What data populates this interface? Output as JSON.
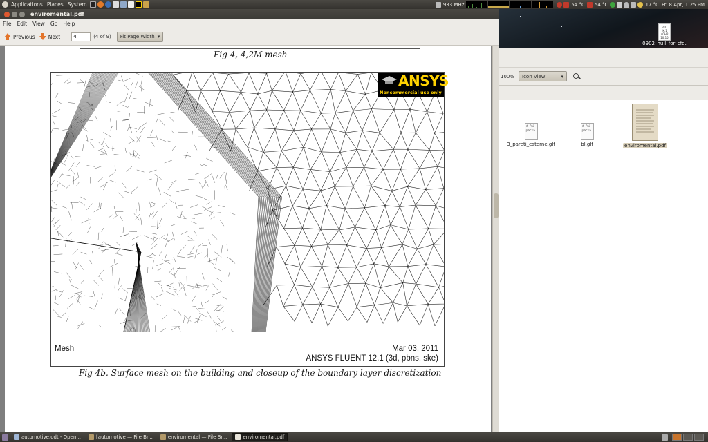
{
  "top_panel": {
    "menus": [
      "Applications",
      "Places",
      "System"
    ],
    "cpu_freq": "933 MHz",
    "temp_1": "54 °C",
    "temp_2": "54 °C",
    "weather": "17 °C",
    "clock": "Fri 8 Apr, 1:25 PM"
  },
  "desktop": {
    "file_label": "0902_hull_for_cfd.",
    "file_thumb_lines": [
      "PTC",
      "IK,1",
      "40HP",
      "10.15"
    ]
  },
  "file_browser": {
    "zoom": "100%",
    "view_mode": "Icon View",
    "files": [
      {
        "name": "3_pareti_esterne.glf",
        "thumb": [
          "# Poi",
          "packa"
        ],
        "selected": false
      },
      {
        "name": "bl.glf",
        "thumb": [
          "# Poi",
          "packa"
        ],
        "selected": false
      },
      {
        "name": "enviromental.pdf",
        "thumb": [],
        "selected": true
      }
    ]
  },
  "viewer": {
    "window_title": "enviromental.pdf",
    "menu": [
      "File",
      "Edit",
      "View",
      "Go",
      "Help"
    ],
    "previous_label": "Previous",
    "next_label": "Next",
    "page_value": "4",
    "page_count": "(4 of 9)",
    "zoom_mode": "Fit Page Width"
  },
  "document": {
    "caption_top": "Fig 4, 4,2M mesh",
    "caption_bottom": "Fig 4b. Surface mesh on the building and closeup of the boundary layer discretization",
    "figure": {
      "logo_text": "ANSYS",
      "logo_subtext": "Noncommercial use only",
      "footer_left": "Mesh",
      "footer_date": "Mar 03, 2011",
      "footer_solver": "ANSYS FLUENT 12.1 (3d, pbns, ske)"
    }
  },
  "taskbar": {
    "tasks": [
      {
        "label": "automotive.odt - Open...",
        "active": false
      },
      {
        "label": "[automotive — File Br...",
        "active": false
      },
      {
        "label": "enviromental — File Br...",
        "active": false
      },
      {
        "label": "enviromental.pdf",
        "active": true
      }
    ]
  },
  "colors": {
    "panel": "#3c3b37",
    "accent_orange": "#e3742a",
    "ansys_yellow": "#ffd200",
    "window_bg": "#edebe7"
  }
}
